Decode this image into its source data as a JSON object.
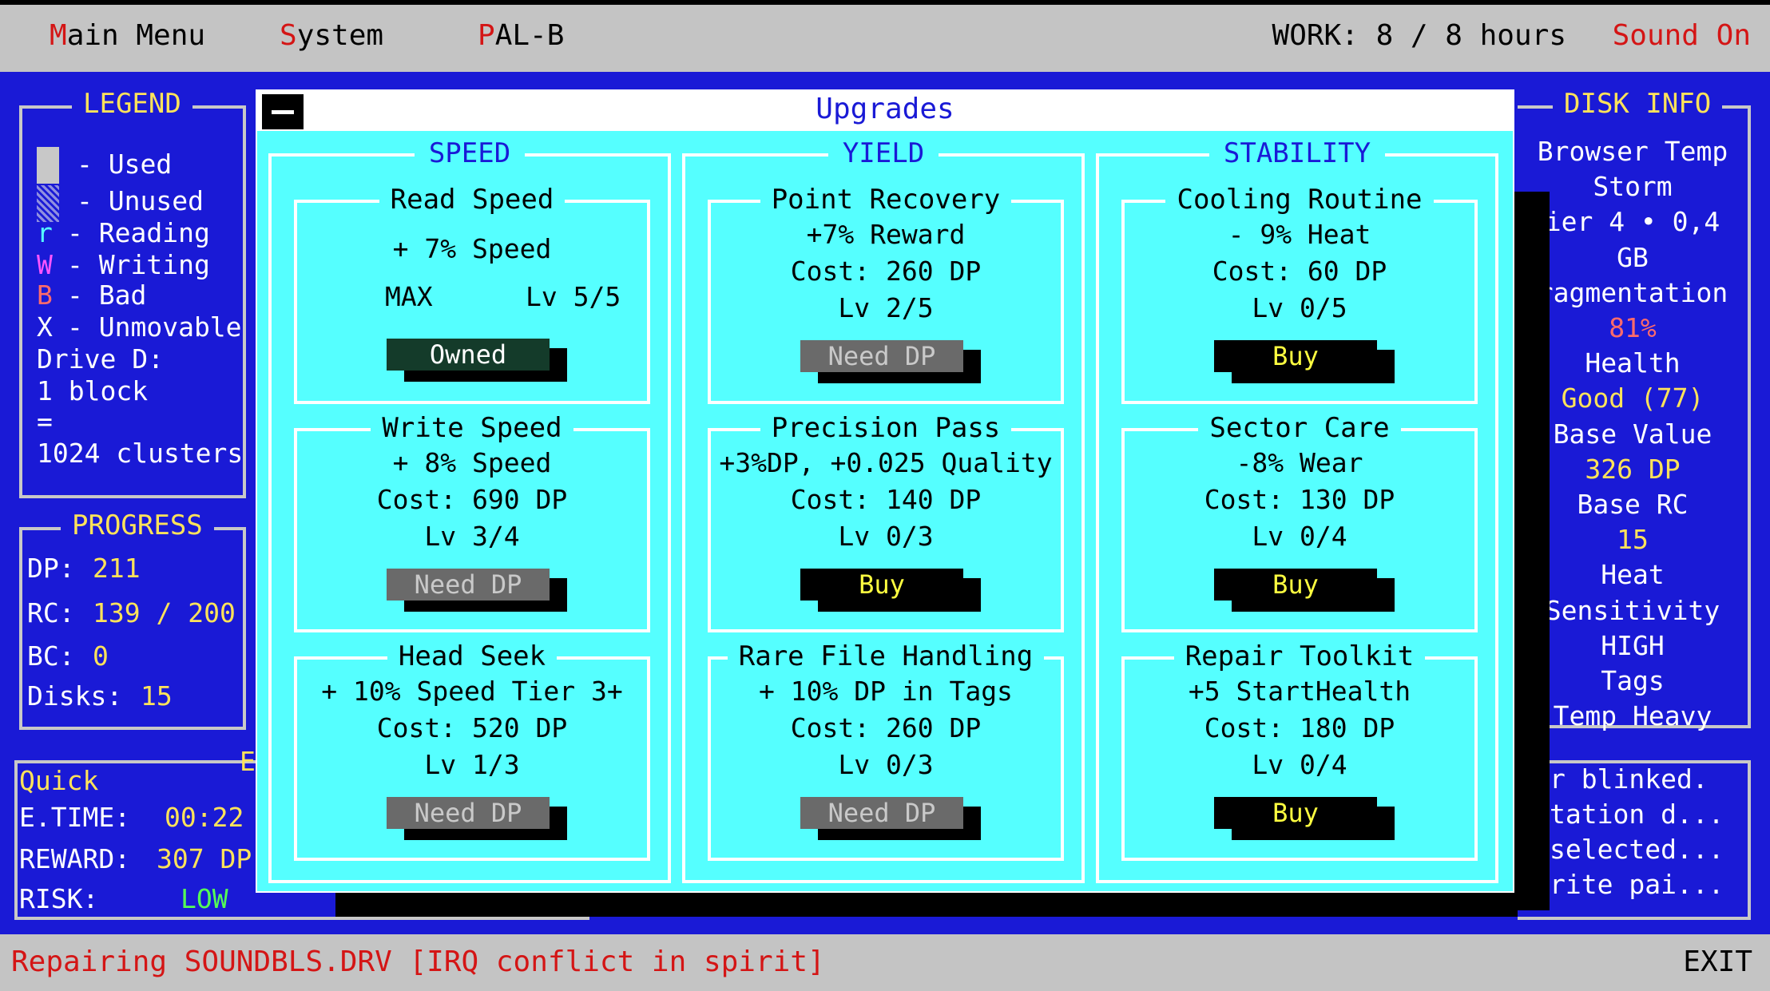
{
  "menubar": {
    "items": [
      {
        "hot": "M",
        "rest": "ain Menu"
      },
      {
        "hot": "S",
        "rest": "ystem"
      },
      {
        "hot": "P",
        "rest": "AL-B"
      }
    ],
    "work": "WORK: 8 / 8 hours",
    "sound": "Sound On"
  },
  "legend": {
    "title": "LEGEND",
    "used": "- Used",
    "unused": "- Unused",
    "reading_key": "r",
    "reading": "- Reading",
    "writing_key": "W",
    "writing": "- Writing",
    "bad_key": "B",
    "bad": "- Bad",
    "unmov_key": "X",
    "unmovable": "- Unmovable",
    "drive": "Drive D:",
    "block": "1 block",
    "eq": "=",
    "clusters": "1024 clusters"
  },
  "progress": {
    "title": "PROGRESS",
    "dp_label": "DP:",
    "dp": "211",
    "rc_label": "RC:",
    "rc": "139 / 200",
    "bc_label": "BC:",
    "bc": "0",
    "disks_label": "Disks:",
    "disks": "15"
  },
  "quick": {
    "label": "Quick",
    "corner": "E",
    "etime_label": "E.TIME:",
    "etime": "00:22",
    "reward_label": "REWARD:",
    "reward": "307 DP",
    "risk_label": "RISK:",
    "risk": "LOW"
  },
  "disk_info": {
    "title": "DISK INFO",
    "lines": [
      "Browser Temp",
      "Storm",
      "ier 4 • 0,4",
      "GB",
      "ragmentation",
      "81%",
      "Health",
      "Good (77)",
      "Base Value",
      "326 DP",
      "Base RC",
      "15",
      "Heat",
      "Sensitivity",
      "HIGH",
      "Tags",
      "Temp Heavy"
    ]
  },
  "log": {
    "lines": [
      "r blinked.",
      "tation d...",
      "selected...",
      "rite pai..."
    ]
  },
  "modal": {
    "title": "Upgrades",
    "columns": [
      {
        "title": "SPEED",
        "cards": [
          {
            "title": "Read Speed",
            "l1": "+ 7% Speed",
            "max": "MAX",
            "lv": "Lv 5/5",
            "btn": "Owned",
            "state": "owned"
          },
          {
            "title": "Write Speed",
            "l1": "+ 8% Speed",
            "l2": "Cost: 690 DP",
            "l3": "Lv 3/4",
            "btn": "Need DP",
            "state": "need"
          },
          {
            "title": "Head Seek",
            "l1": "+ 10% Speed Tier 3+",
            "l2": "Cost: 520 DP",
            "l3": "Lv 1/3",
            "btn": "Need DP",
            "state": "need"
          }
        ]
      },
      {
        "title": "YIELD",
        "cards": [
          {
            "title": "Point Recovery",
            "l1": "+7% Reward",
            "l2": "Cost: 260 DP",
            "l3": "Lv 2/5",
            "btn": "Need DP",
            "state": "need"
          },
          {
            "title": "Precision Pass",
            "l1": "+3%DP, +0.025 Quality",
            "l2": "Cost: 140 DP",
            "l3": "Lv 0/3",
            "btn": "Buy",
            "state": "buy"
          },
          {
            "title": "Rare File Handling",
            "l1": "+ 10% DP in Tags",
            "l2": "Cost: 260 DP",
            "l3": "Lv 0/3",
            "btn": "Need DP",
            "state": "need"
          }
        ]
      },
      {
        "title": "STABILITY",
        "cards": [
          {
            "title": "Cooling Routine",
            "l1": "- 9% Heat",
            "l2": "Cost: 60 DP",
            "l3": "Lv 0/5",
            "btn": "Buy",
            "state": "buy"
          },
          {
            "title": "Sector Care",
            "l1": "-8% Wear",
            "l2": "Cost: 130 DP",
            "l3": "Lv 0/4",
            "btn": "Buy",
            "state": "buy"
          },
          {
            "title": "Repair Toolkit",
            "l1": "+5 StartHealth",
            "l2": "Cost: 180 DP",
            "l3": "Lv 0/4",
            "btn": "Buy",
            "state": "buy"
          }
        ]
      }
    ]
  },
  "status": {
    "message": "Repairing SOUNDBLS.DRV [IRQ conflict in spirit]",
    "exit": "EXIT"
  },
  "colors": {
    "background": "#1a1ad6",
    "modal": "#55ffff",
    "accent_yellow": "#ffe35a",
    "accent_red": "#d41515",
    "buy_text": "#ffff40"
  }
}
